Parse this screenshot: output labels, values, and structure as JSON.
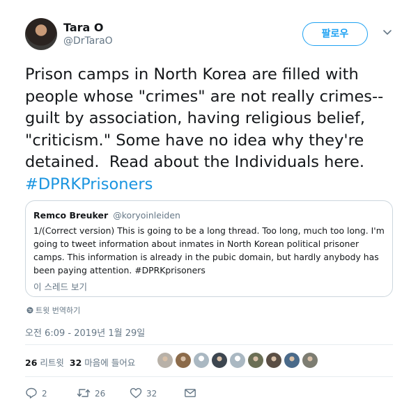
{
  "user": {
    "name": "Tara O",
    "handle": "@DrTaraO",
    "follow_label": "팔로우"
  },
  "tweet": {
    "text": "Prison camps in North Korea are filled with people whose \"crimes\" are not really crimes--guilt by association, having religious belief, \"criticism.\" Some have no idea why they're detained.  Read about the Individuals here. ",
    "hashtag": "#DPRKPrisoners"
  },
  "quote": {
    "name": "Remco Breuker",
    "handle": "@koryoinleiden",
    "text": "1/(Correct version) This is going to be a long thread. Too long, much too long. I'm going to tweet information about inmates in North Korean political prisoner camps. This information is already in the pubic domain, but hardly anybody has been paying attention. #DPRKprisoners",
    "thread_link": "이 스레드 보기"
  },
  "translate_label": "트윗 번역하기",
  "timestamp": "오전 6:09 - 2019년 1월 29일",
  "stats": {
    "retweets_count": "26",
    "retweets_label": "리트윗",
    "likes_count": "32",
    "likes_label": "마음에 들어요"
  },
  "likers": [
    {
      "name": "liker-avatar-1",
      "color": "#b8b1a8"
    },
    {
      "name": "liker-avatar-2",
      "color": "#8c6b4a"
    },
    {
      "name": "liker-avatar-3",
      "color": "default"
    },
    {
      "name": "liker-avatar-4",
      "color": "#3d4650"
    },
    {
      "name": "liker-avatar-5",
      "color": "default"
    },
    {
      "name": "liker-avatar-6",
      "color": "#6b6f55"
    },
    {
      "name": "liker-avatar-7",
      "color": "#5a4e44"
    },
    {
      "name": "liker-avatar-8",
      "color": "#4a6a8a"
    },
    {
      "name": "liker-avatar-9",
      "color": "#7d7d72"
    }
  ],
  "actions": {
    "reply_count": "2",
    "retweet_count": "26",
    "like_count": "32"
  },
  "colors": {
    "accent": "#1da1f2",
    "hashtag": "#1b95e0",
    "secondary_text": "#657786",
    "border": "#ccd6dd"
  }
}
